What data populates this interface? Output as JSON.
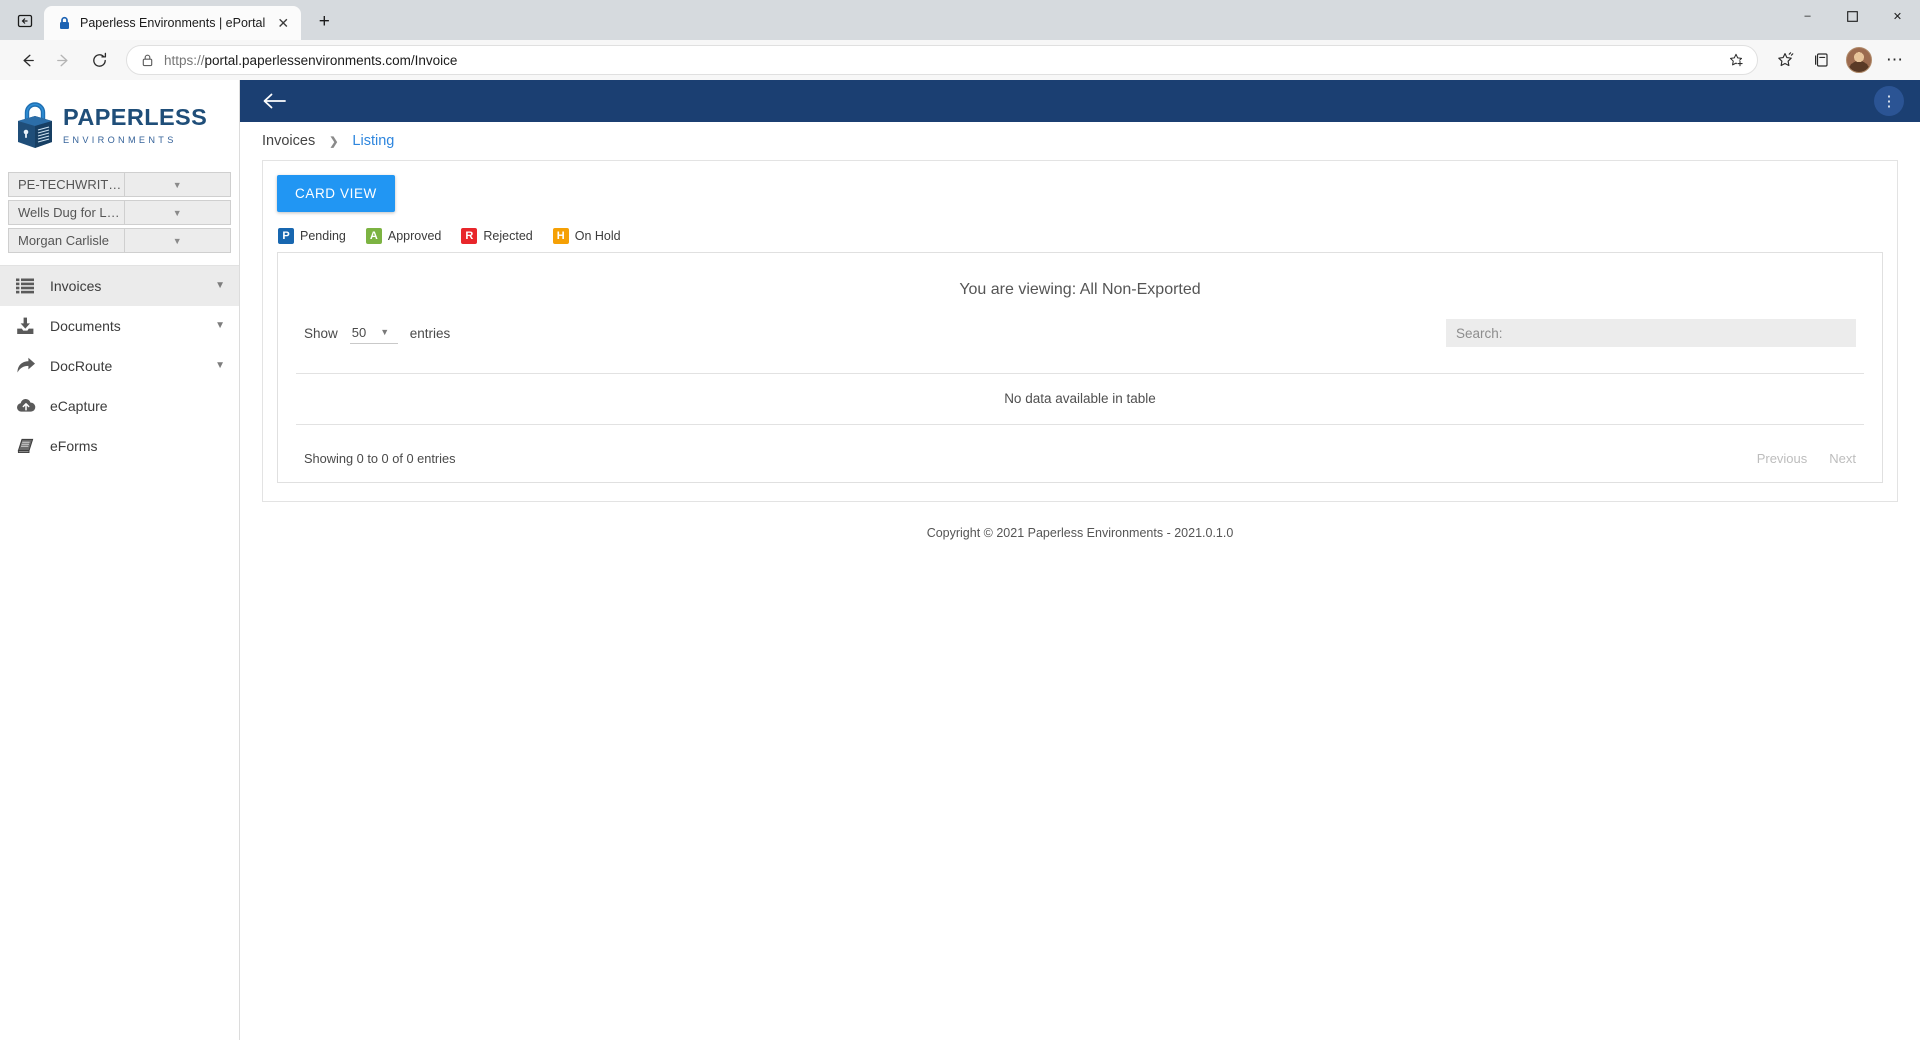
{
  "browser": {
    "tab": {
      "title": "Paperless Environments | ePortal",
      "favicon_icon": "lock-icon",
      "close_icon": "close-icon"
    },
    "new_tab_icon": "plus-icon",
    "tab_list_icon": "tab-list-icon",
    "nav": {
      "back_icon": "back-arrow-icon",
      "forward_icon": "forward-arrow-icon",
      "reload_icon": "reload-icon"
    },
    "omnibox": {
      "lock_icon": "site-info-lock-icon",
      "url_prefix": "https://",
      "url_host": "portal.paperlessenvironments.com",
      "url_path": "/Invoice",
      "favorite_icon": "add-favorite-icon"
    },
    "toolbar_right": {
      "collections_icon": "favorites-icon",
      "split_icon": "collections-icon",
      "profile_icon": "avatar",
      "settings_icon": "more-settings-icon"
    },
    "window": {
      "minimize": "–",
      "maximize": "❐",
      "close": "✕"
    }
  },
  "sidebar": {
    "logo": {
      "title": "PAPERLESS",
      "subtitle": "ENVIRONMENTS",
      "icon": "paperless-padlock-logo"
    },
    "selects": [
      {
        "value": "PE-TECHWRITING",
        "name": "tenant-select"
      },
      {
        "value": "Wells Dug for Less",
        "name": "company-select"
      },
      {
        "value": "Morgan Carlisle",
        "name": "user-select"
      }
    ],
    "nav": [
      {
        "label": "Invoices",
        "icon": "list-icon",
        "active": true,
        "chevron": true
      },
      {
        "label": "Documents",
        "icon": "download-inbox-icon",
        "active": false,
        "chevron": true
      },
      {
        "label": "DocRoute",
        "icon": "forward-arrow-icon",
        "active": false,
        "chevron": true
      },
      {
        "label": "eCapture",
        "icon": "cloud-upload-icon",
        "active": false,
        "chevron": false
      },
      {
        "label": "eForms",
        "icon": "book-icon",
        "active": false,
        "chevron": false
      }
    ]
  },
  "topbar": {
    "back_icon": "back-arrow-icon",
    "menu_icon": "kebab-menu-icon"
  },
  "breadcrumb": {
    "parent": "Invoices",
    "separator": "❯",
    "current": "Listing"
  },
  "main": {
    "card_view_button": "CARD VIEW",
    "legend": [
      {
        "letter": "P",
        "label": "Pending",
        "color": "#1867b0"
      },
      {
        "letter": "A",
        "label": "Approved",
        "color": "#7cb342"
      },
      {
        "letter": "R",
        "label": "Rejected",
        "color": "#e8262b"
      },
      {
        "letter": "H",
        "label": "On Hold",
        "color": "#f5a005"
      }
    ],
    "viewing_text": "You are viewing: All Non-Exported",
    "table_controls": {
      "show_label": "Show",
      "page_length": "50",
      "entries_label": "entries",
      "search_placeholder": "Search:",
      "search_value": ""
    },
    "table": {
      "empty_message": "No data available in table",
      "info": "Showing 0 to 0 of 0 entries",
      "previous_label": "Previous",
      "next_label": "Next"
    }
  },
  "footer": {
    "copyright": "Copyright © 2021 Paperless Environments - 2021.0.1.0"
  }
}
